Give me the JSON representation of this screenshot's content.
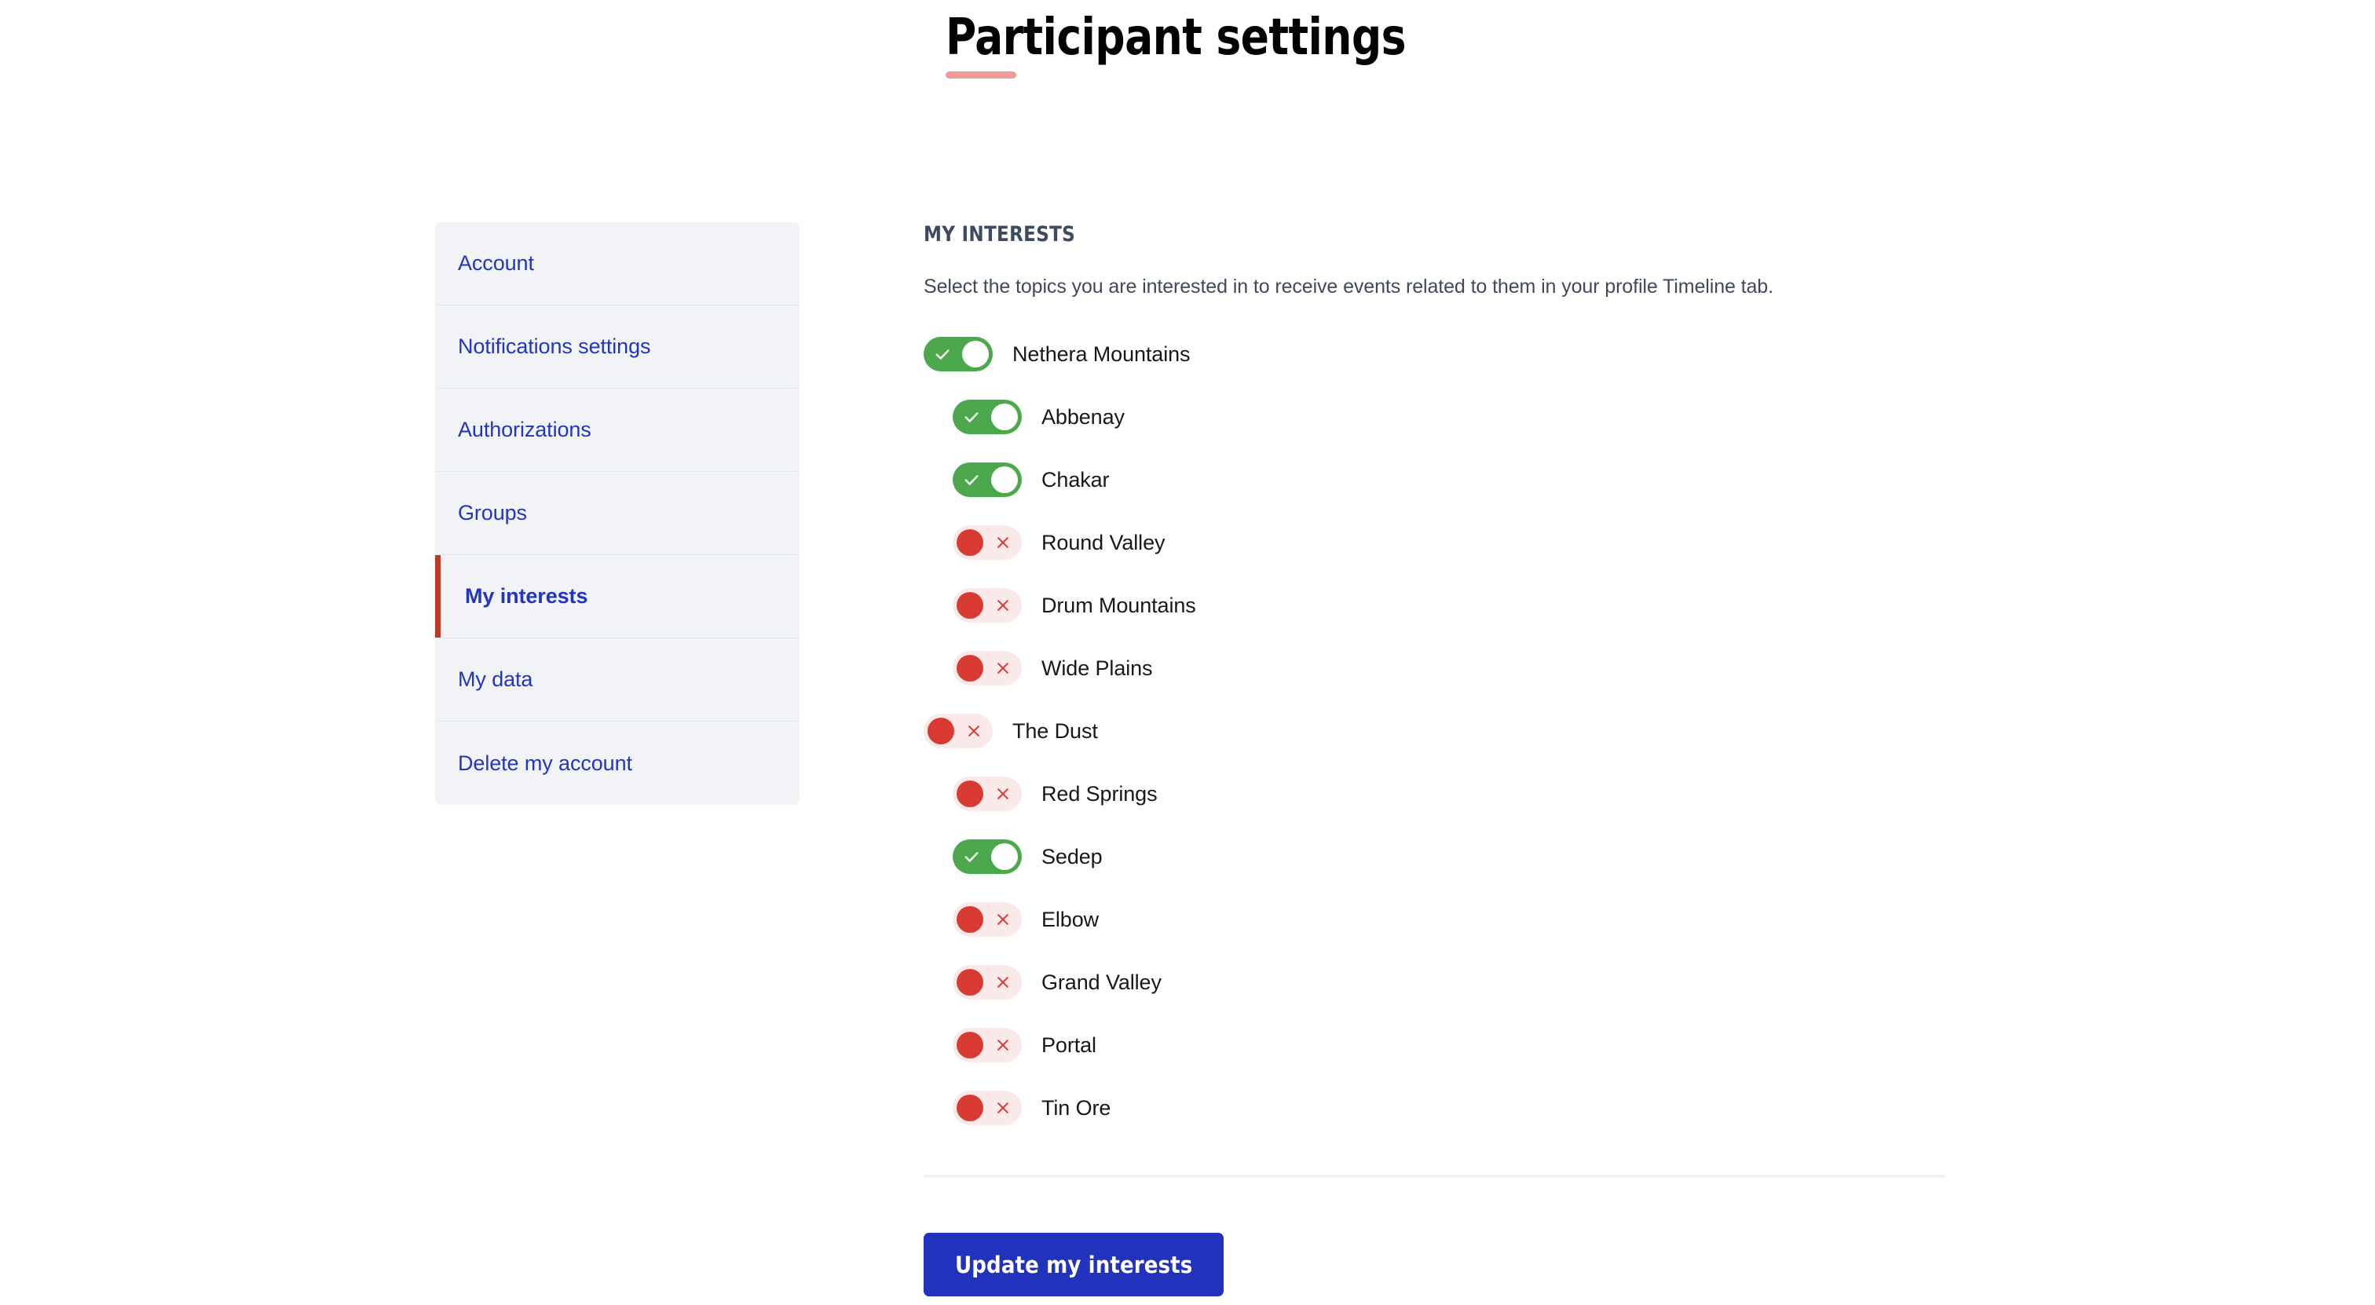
{
  "header": {
    "title": "Participant settings",
    "accent_color": "#ee9a95"
  },
  "sidebar": {
    "items": [
      {
        "label": "Account",
        "active": false
      },
      {
        "label": "Notifications settings",
        "active": false
      },
      {
        "label": "Authorizations",
        "active": false
      },
      {
        "label": "Groups",
        "active": false
      },
      {
        "label": "My interests",
        "active": true
      },
      {
        "label": "My data",
        "active": false
      },
      {
        "label": "Delete my account",
        "active": false
      }
    ],
    "link_color": "#2235c0",
    "active_marker_color": "#bc3b28",
    "background_color": "#f1f3f7"
  },
  "main": {
    "section_title": "MY INTERESTS",
    "section_description": "Select the topics you are interested in to receive events related to them in your profile Timeline tab.",
    "toggle_on_color": "#4ca84c",
    "toggle_off_color": "#d83a32",
    "toggle_off_track_color": "#fbe8e8",
    "interests": [
      {
        "label": "Nethera Mountains",
        "enabled": true,
        "level": 0
      },
      {
        "label": "Abbenay",
        "enabled": true,
        "level": 1
      },
      {
        "label": "Chakar",
        "enabled": true,
        "level": 1
      },
      {
        "label": "Round Valley",
        "enabled": false,
        "level": 1
      },
      {
        "label": "Drum Mountains",
        "enabled": false,
        "level": 1
      },
      {
        "label": "Wide Plains",
        "enabled": false,
        "level": 1
      },
      {
        "label": "The Dust",
        "enabled": false,
        "level": 0
      },
      {
        "label": "Red Springs",
        "enabled": false,
        "level": 1
      },
      {
        "label": "Sedep",
        "enabled": true,
        "level": 1
      },
      {
        "label": "Elbow",
        "enabled": false,
        "level": 1
      },
      {
        "label": "Grand Valley",
        "enabled": false,
        "level": 1
      },
      {
        "label": "Portal",
        "enabled": false,
        "level": 1
      },
      {
        "label": "Tin Ore",
        "enabled": false,
        "level": 1
      }
    ],
    "submit_label": "Update my interests",
    "submit_color": "#2133bd"
  }
}
